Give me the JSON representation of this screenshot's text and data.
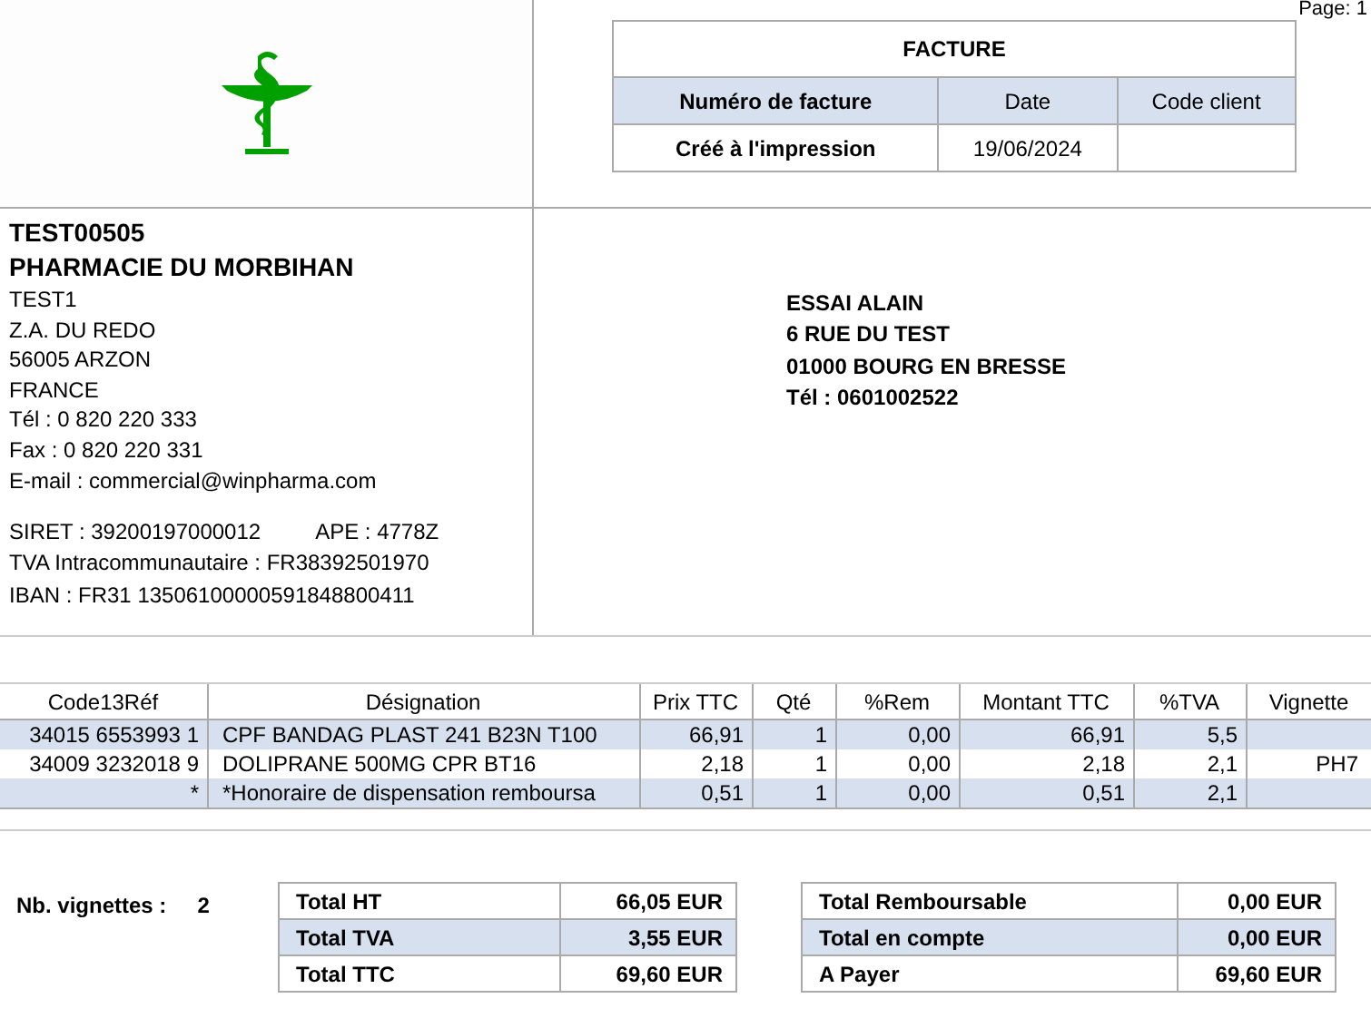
{
  "page_label": "Page: 1",
  "invoice_box": {
    "title": "FACTURE",
    "columns": [
      "Numéro de facture",
      "Date",
      "Code client"
    ],
    "values": [
      "Créé à l'impression",
      "19/06/2024"
    ]
  },
  "pharmacy": {
    "code": "TEST00505",
    "name": "PHARMACIE DU MORBIHAN",
    "address": [
      "TEST1",
      "Z.A. DU REDO",
      "56005 ARZON",
      "FRANCE",
      "Tél : 0 820 220 333",
      "Fax : 0 820 220 331",
      "E-mail : commercial@winpharma.com"
    ],
    "siret": "SIRET : 39200197000012",
    "ape": "APE : 4778Z",
    "tva": "TVA Intracommunautaire : FR38392501970",
    "iban": "IBAN : FR31 13506100000591848800411"
  },
  "client": [
    "ESSAI ALAIN",
    "6 RUE DU TEST",
    "01000 BOURG EN BRESSE",
    "Tél : 0601002522"
  ],
  "lines_table": {
    "columns": [
      "Code13Réf",
      "Désignation",
      "Prix TTC",
      "Qté",
      "%Rem",
      "Montant TTC",
      "%TVA",
      "Vignette"
    ],
    "rows": [
      {
        "code": "34015 6553993 1",
        "designation": "CPF BANDAG PLAST 241 B23N T100",
        "price": "66,91",
        "qty": "1",
        "discount": "0,00",
        "amount": "66,91",
        "vat": "5,5"
      },
      {
        "code": "34009 3232018 9",
        "designation": "DOLIPRANE 500MG CPR BT16",
        "price": "2,18",
        "qty": "1",
        "discount": "0,00",
        "amount": "2,18",
        "vat": "2,1",
        "vignette": "PH7"
      },
      {
        "code": "*",
        "designation": "*Honoraire de dispensation remboursa",
        "price": "0,51",
        "qty": "1",
        "discount": "0,00",
        "amount": "0,51",
        "vat": "2,1"
      }
    ]
  },
  "vignettes": {
    "label": "Nb. vignettes :",
    "value": "2"
  },
  "totals_left": [
    {
      "label": "Total HT",
      "value": "66,05 EUR"
    },
    {
      "label": "Total TVA",
      "value": "3,55 EUR"
    },
    {
      "label": "Total TTC",
      "value": "69,60 EUR"
    }
  ],
  "totals_right": [
    {
      "label": "Total Remboursable",
      "value": "0,00 EUR"
    },
    {
      "label": "Total en compte",
      "value": "0,00 EUR"
    },
    {
      "label": "A Payer",
      "value": "69,60 EUR"
    }
  ]
}
